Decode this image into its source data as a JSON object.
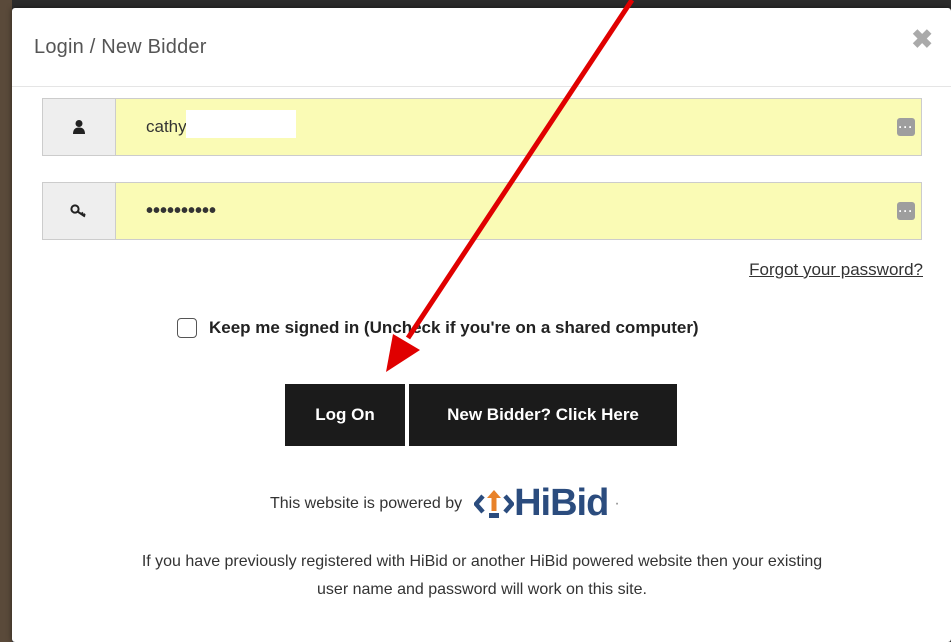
{
  "modal": {
    "title": "Login / New Bidder",
    "close_icon": "close-icon"
  },
  "username": {
    "value": "cathyj",
    "icon": "user-icon"
  },
  "password": {
    "value": "••••••••••",
    "icon": "key-icon"
  },
  "forgot_label": "Forgot your password?",
  "keep_signed_in": {
    "label": "Keep me signed in (Uncheck if you're on a shared computer)",
    "checked": false
  },
  "buttons": {
    "logon": "Log On",
    "new_bidder": "New Bidder? Click Here"
  },
  "powered": {
    "text": "This website is powered by",
    "brand": "HiBid"
  },
  "info": {
    "line1": "If you have previously registered with HiBid or another HiBid powered website then your existing",
    "line2": "user name and password will work on this site."
  },
  "colors": {
    "input_bg": "#fafbb5",
    "button_bg": "#1b1b1b",
    "brand": "#2b4c7e",
    "annotation_arrow": "#e00000"
  }
}
